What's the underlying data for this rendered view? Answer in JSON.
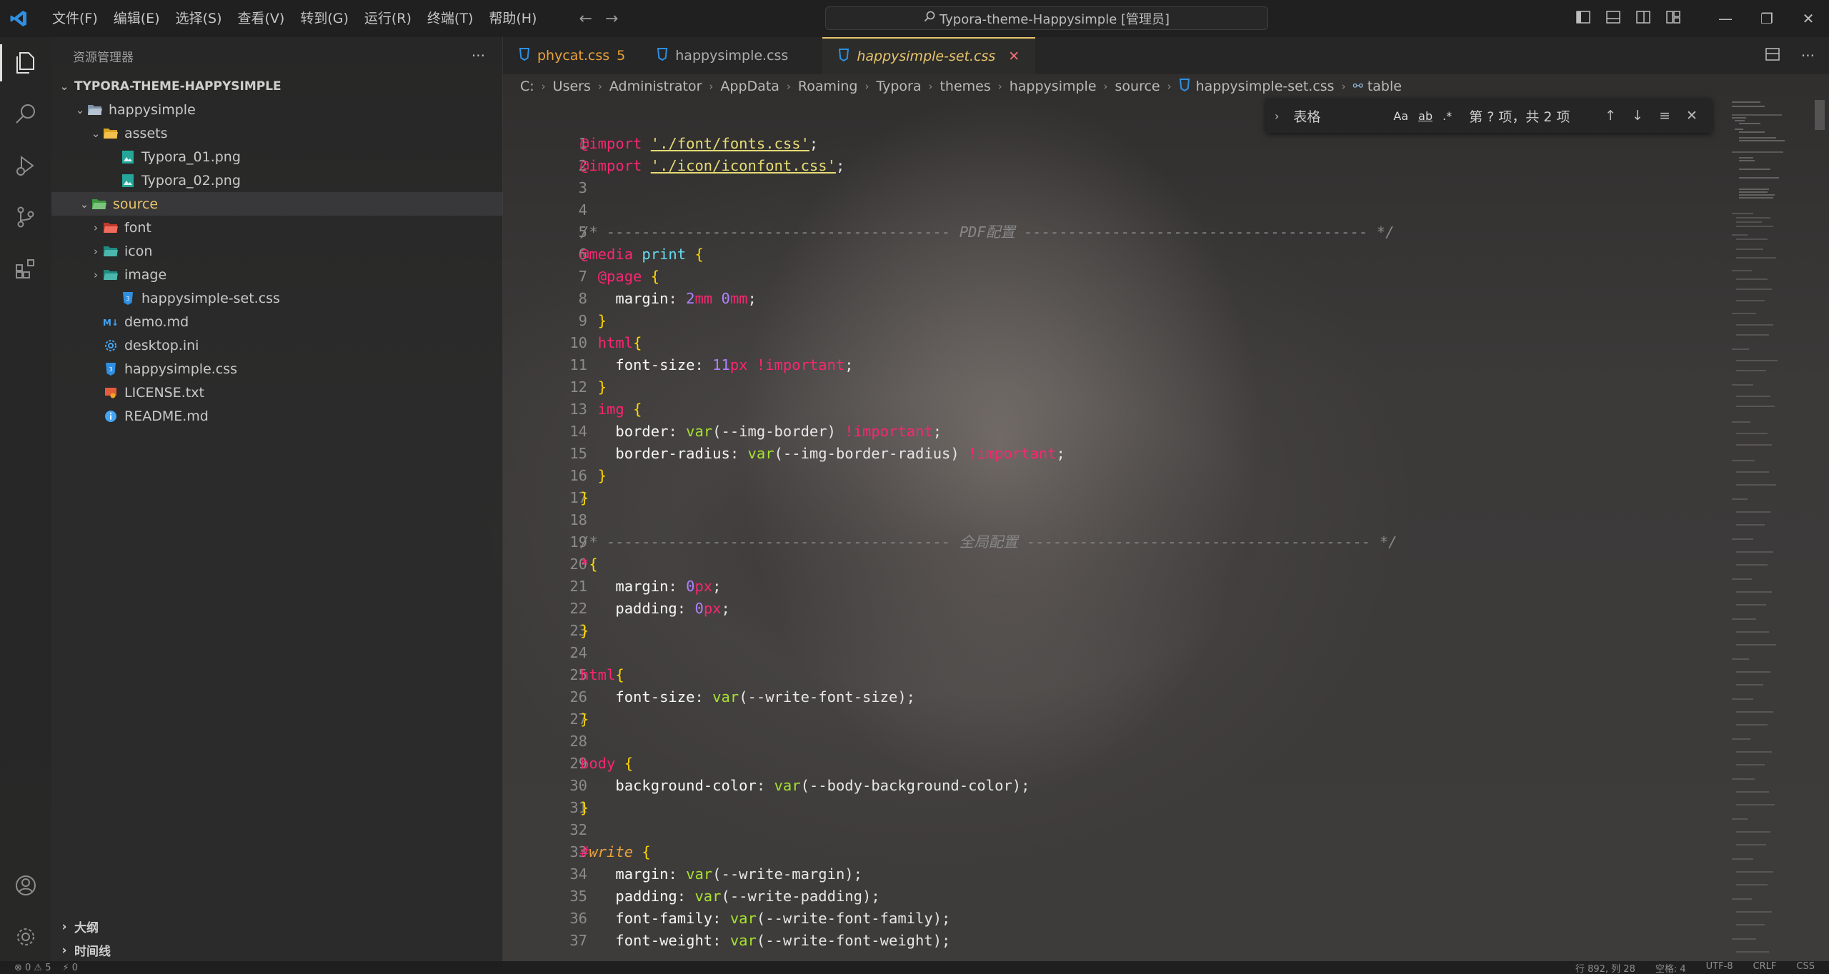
{
  "titlebar": {
    "menu": [
      "文件(F)",
      "编辑(E)",
      "选择(S)",
      "查看(V)",
      "转到(G)",
      "运行(R)",
      "终端(T)",
      "帮助(H)"
    ],
    "search_title": "Typora-theme-Happysimple [管理员]"
  },
  "sidebar": {
    "title": "资源管理器",
    "root": "TYPORA-THEME-HAPPYSIMPLE",
    "items": [
      {
        "label": "happysimple",
        "kind": "folder-open"
      },
      {
        "label": "assets",
        "kind": "folder-open"
      },
      {
        "label": "Typora_01.png",
        "kind": "image"
      },
      {
        "label": "Typora_02.png",
        "kind": "image"
      },
      {
        "label": "source",
        "kind": "folder-open"
      },
      {
        "label": "font",
        "kind": "folder"
      },
      {
        "label": "icon",
        "kind": "folder"
      },
      {
        "label": "image",
        "kind": "folder"
      },
      {
        "label": "happysimple-set.css",
        "kind": "css"
      },
      {
        "label": "demo.md",
        "kind": "md"
      },
      {
        "label": "desktop.ini",
        "kind": "gear"
      },
      {
        "label": "happysimple.css",
        "kind": "css"
      },
      {
        "label": "LICENSE.txt",
        "kind": "license"
      },
      {
        "label": "README.md",
        "kind": "info"
      }
    ],
    "outline": "大纲",
    "timeline": "时间线"
  },
  "tabs": [
    {
      "label": "phycat.css",
      "badge": "5"
    },
    {
      "label": "happysimple.css",
      "badge": ""
    },
    {
      "label": "happysimple-set.css",
      "badge": ""
    }
  ],
  "breadcrumb": [
    "C:",
    "Users",
    "Administrator",
    "AppData",
    "Roaming",
    "Typora",
    "themes",
    "happysimple",
    "source",
    "happysimple-set.css",
    "table"
  ],
  "find": {
    "query": "表格",
    "opt_case": "Aa",
    "opt_word": "ab",
    "opt_regex": ".*",
    "result": "第 ? 项，共 2 项"
  },
  "code": {
    "line_numbers": [
      "1",
      "2",
      "3",
      "4",
      "5",
      "6",
      "7",
      "8",
      "9",
      "10",
      "11",
      "12",
      "13",
      "14",
      "15",
      "16",
      "17",
      "18",
      "19",
      "20",
      "21",
      "22",
      "23",
      "24",
      "25",
      "26",
      "27",
      "28",
      "29",
      "30",
      "31",
      "32",
      "33",
      "34",
      "35",
      "36",
      "37"
    ],
    "import1": "'./font/fonts.css'",
    "import2": "'./icon/iconfont.css'",
    "comment_pdf": "/* --------------------------------------- PDF配置 --------------------------------------- */",
    "comment_global": "/* --------------------------------------- 全局配置 --------------------------------------- */"
  },
  "statusbar": {
    "left": [
      "⊗ 0 ⚠ 5",
      "⚡ 0"
    ],
    "right": [
      "行 892, 列 28",
      "空格: 4",
      "UTF-8",
      "CRLF",
      "CSS"
    ]
  }
}
